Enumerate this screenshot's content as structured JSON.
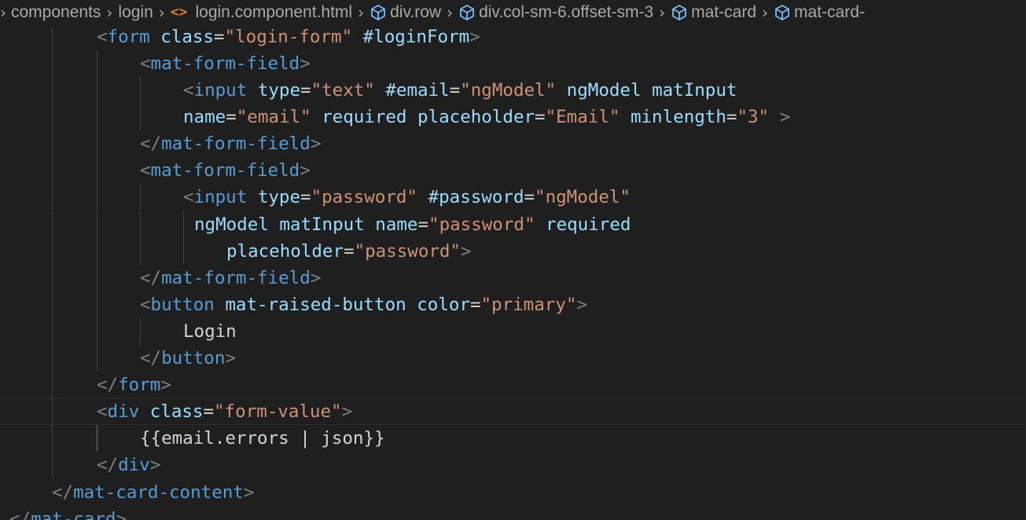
{
  "breadcrumb": [
    {
      "label": "components",
      "icon": "none"
    },
    {
      "label": "login",
      "icon": "none"
    },
    {
      "label": "login.component.html",
      "icon": "html-file-icon"
    },
    {
      "label": "div.row",
      "icon": "cube-icon"
    },
    {
      "label": "div.col-sm-6.offset-sm-3",
      "icon": "cube-icon"
    },
    {
      "label": "mat-card",
      "icon": "cube-icon"
    },
    {
      "label": "mat-card-",
      "icon": "cube-icon"
    }
  ],
  "theme": {
    "background": "#1f1f1f",
    "punctuation": "#808080",
    "tag": "#569cd6",
    "attribute": "#9cdcfe",
    "string": "#ce9178",
    "text": "#d4d4d4"
  },
  "code": {
    "lines": [
      [
        [
          "p",
          "<"
        ],
        [
          "t",
          "form"
        ],
        [
          "x",
          " "
        ],
        [
          "a",
          "class"
        ],
        [
          "x",
          "="
        ],
        [
          "s",
          "\"login-form\""
        ],
        [
          "x",
          " "
        ],
        [
          "a",
          "#loginForm"
        ],
        [
          "p",
          ">"
        ]
      ],
      [
        [
          "p",
          "<"
        ],
        [
          "t",
          "mat-form-field"
        ],
        [
          "p",
          ">"
        ]
      ],
      [
        [
          "p",
          "<"
        ],
        [
          "t",
          "input"
        ],
        [
          "x",
          " "
        ],
        [
          "a",
          "type"
        ],
        [
          "x",
          "="
        ],
        [
          "s",
          "\"text\""
        ],
        [
          "x",
          " "
        ],
        [
          "a",
          "#email"
        ],
        [
          "x",
          "="
        ],
        [
          "s",
          "\"ngModel\""
        ],
        [
          "x",
          " "
        ],
        [
          "a",
          "ngModel"
        ],
        [
          "x",
          " "
        ],
        [
          "a",
          "matInput"
        ]
      ],
      [
        [
          "a",
          "name"
        ],
        [
          "x",
          "="
        ],
        [
          "s",
          "\"email\""
        ],
        [
          "x",
          " "
        ],
        [
          "a",
          "required"
        ],
        [
          "x",
          " "
        ],
        [
          "a",
          "placeholder"
        ],
        [
          "x",
          "="
        ],
        [
          "s",
          "\"Email\""
        ],
        [
          "x",
          " "
        ],
        [
          "a",
          "minlength"
        ],
        [
          "x",
          "="
        ],
        [
          "s",
          "\"3\""
        ],
        [
          "x",
          " "
        ],
        [
          "p",
          ">"
        ]
      ],
      [
        [
          "p",
          "</"
        ],
        [
          "t",
          "mat-form-field"
        ],
        [
          "p",
          ">"
        ]
      ],
      [
        [
          "p",
          "<"
        ],
        [
          "t",
          "mat-form-field"
        ],
        [
          "p",
          ">"
        ]
      ],
      [
        [
          "p",
          "<"
        ],
        [
          "t",
          "input"
        ],
        [
          "x",
          " "
        ],
        [
          "a",
          "type"
        ],
        [
          "x",
          "="
        ],
        [
          "s",
          "\"password\""
        ],
        [
          "x",
          " "
        ],
        [
          "a",
          "#password"
        ],
        [
          "x",
          "="
        ],
        [
          "s",
          "\"ngModel\""
        ]
      ],
      [
        [
          "a",
          "ngModel"
        ],
        [
          "x",
          " "
        ],
        [
          "a",
          "matInput"
        ],
        [
          "x",
          " "
        ],
        [
          "a",
          "name"
        ],
        [
          "x",
          "="
        ],
        [
          "s",
          "\"password\""
        ],
        [
          "x",
          " "
        ],
        [
          "a",
          "required"
        ]
      ],
      [
        [
          "a",
          "placeholder"
        ],
        [
          "x",
          "="
        ],
        [
          "s",
          "\"password\""
        ],
        [
          "p",
          ">"
        ]
      ],
      [
        [
          "p",
          "</"
        ],
        [
          "t",
          "mat-form-field"
        ],
        [
          "p",
          ">"
        ]
      ],
      [
        [
          "p",
          "<"
        ],
        [
          "t",
          "button"
        ],
        [
          "x",
          " "
        ],
        [
          "a",
          "mat-raised-button"
        ],
        [
          "x",
          " "
        ],
        [
          "a",
          "color"
        ],
        [
          "x",
          "="
        ],
        [
          "s",
          "\"primary\""
        ],
        [
          "p",
          ">"
        ]
      ],
      [
        [
          "x",
          "Login"
        ]
      ],
      [
        [
          "p",
          "</"
        ],
        [
          "t",
          "button"
        ],
        [
          "p",
          ">"
        ]
      ],
      [
        [
          "p",
          "</"
        ],
        [
          "t",
          "form"
        ],
        [
          "p",
          ">"
        ]
      ],
      [
        [
          "p",
          "<"
        ],
        [
          "t",
          "div"
        ],
        [
          "x",
          " "
        ],
        [
          "a",
          "class"
        ],
        [
          "x",
          "="
        ],
        [
          "s",
          "\"form-value\""
        ],
        [
          "p",
          ">"
        ]
      ],
      [
        [
          "x",
          "{{email.errors | json}}"
        ]
      ],
      [
        [
          "p",
          "</"
        ],
        [
          "t",
          "div"
        ],
        [
          "p",
          ">"
        ]
      ],
      [
        [
          "p",
          "</"
        ],
        [
          "t",
          "mat-card-content"
        ],
        [
          "p",
          ">"
        ]
      ],
      [
        [
          "p",
          "</"
        ],
        [
          "t",
          "mat-card"
        ],
        [
          "p",
          ">"
        ]
      ]
    ]
  }
}
